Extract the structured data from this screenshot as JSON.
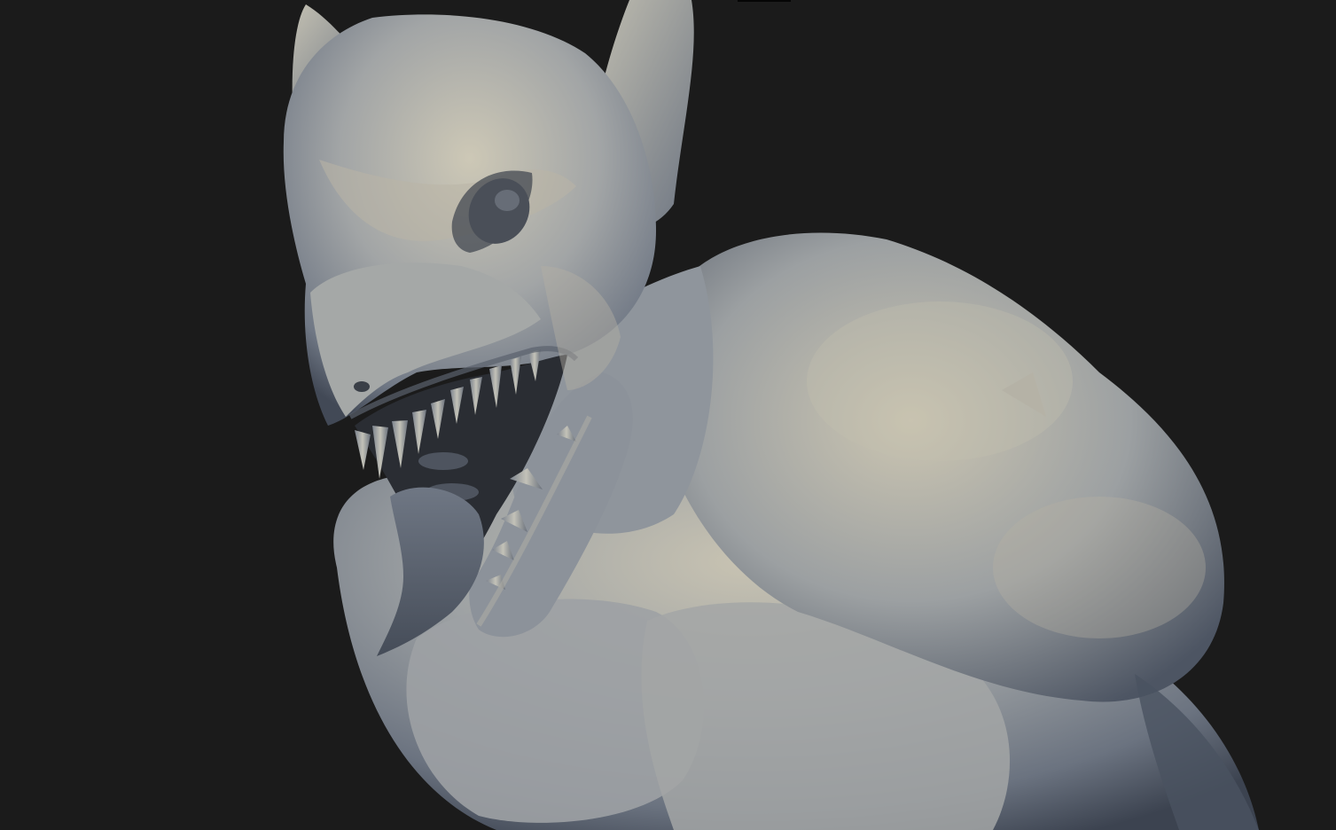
{
  "viewport": {
    "background_color": "#1b1b1b",
    "subject": "sculpt-model"
  },
  "palette": {
    "clay_light": "#c9c5b6",
    "clay_mid": "#8e939a",
    "clay_shadow": "#3e4450",
    "clay_warm": "#a89a80",
    "mouth_dark": "#2a2d33",
    "eye": "#4a4e55"
  },
  "icons": {
    "top_marker": "viewport-top-marker"
  }
}
